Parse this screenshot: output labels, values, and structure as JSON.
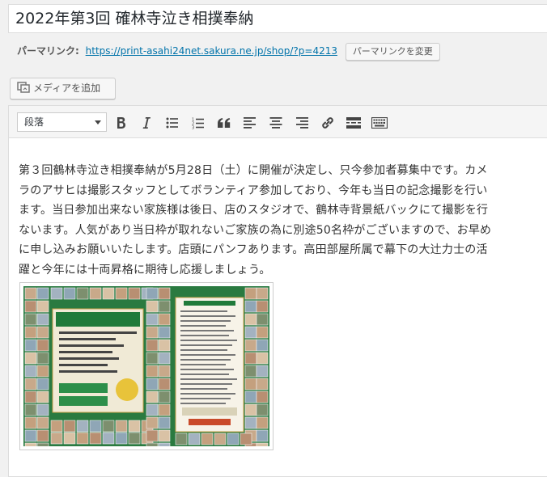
{
  "post": {
    "title": "2022年第3回 確林寺泣き相撲奉納"
  },
  "permalink": {
    "label": "パーマリンク:",
    "url": "https://print-asahi24net.sakura.ne.jp/shop/?p=4213",
    "change_button": "パーマリンクを変更"
  },
  "media": {
    "add_button": "メディアを追加"
  },
  "toolbar": {
    "format_value": "段落",
    "buttons": [
      "bold",
      "italic",
      "bulleted-list",
      "numbered-list",
      "blockquote",
      "align-left",
      "align-center",
      "align-right",
      "insert-link",
      "read-more",
      "toolbar-toggle"
    ]
  },
  "content": {
    "paragraph": "第３回鶴林寺泣き相撲奉納が5月28日（土）に開催が決定し、只今参加者募集中です。カメラのアサヒは撮影スタッフとしてボランティア参加しており、今年も当日の記念撮影を行います。当日参加出来ない家族様は後日、店のスタジオで、鶴林寺背景紙バックにて撮影を行ないます。人気があり当日枠が取れないご家族の為に別途50名枠がございますので、お早めに申し込みお願いいたします。店頭にパンフあります。高田部屋所属で幕下の大辻力士の活躍と今年には十両昇格に期待し応援しましょう。"
  },
  "colors": {
    "link": "#0073aa",
    "flyer_green": "#1f7a3a"
  }
}
